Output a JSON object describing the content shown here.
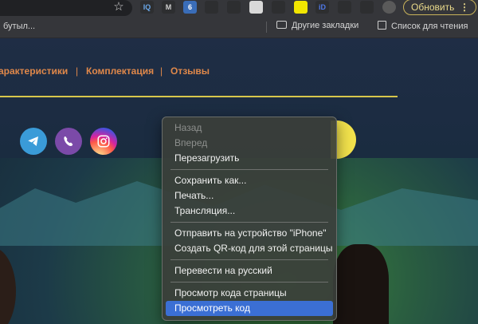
{
  "toolbar": {
    "update_label": "Обновить",
    "menu_glyph": "⋮",
    "extensions": [
      {
        "name": "iq-extension",
        "label": "IQ",
        "bg": "#2d2e30",
        "color": "#6aa7e8"
      },
      {
        "name": "m-extension",
        "label": "M",
        "bg": "#2d2e30",
        "color": "#cfcfcf"
      },
      {
        "name": "code-extension",
        "label": "6",
        "bg": "#3a6db8",
        "color": "#ffffff"
      },
      {
        "name": "feather-extension",
        "label": "",
        "bg": "#2d2e30",
        "color": "#5aa0e8"
      },
      {
        "name": "magnifier-extension",
        "label": "",
        "bg": "#2d2e30",
        "color": "#cfcfcf"
      },
      {
        "name": "note-extension",
        "label": "",
        "bg": "#d9d9d9",
        "color": "#333333"
      },
      {
        "name": "compass-extension",
        "label": "",
        "bg": "#2d2e30",
        "color": "#cfcfcf"
      },
      {
        "name": "yellow-extension",
        "label": "",
        "bg": "#f2e600",
        "color": "#000000"
      },
      {
        "name": "id-extension",
        "label": "iD",
        "bg": "#2d2e30",
        "color": "#4f78e8"
      },
      {
        "name": "puzzle-extension",
        "label": "",
        "bg": "#2d2e30",
        "color": "#cfcfcf"
      },
      {
        "name": "list-extension",
        "label": "",
        "bg": "#2d2e30",
        "color": "#cfcfcf"
      }
    ]
  },
  "bookmarks": {
    "cut_item": "бутыл...",
    "other_bookmarks": "Другие закладки",
    "reading_list": "Список для чтения"
  },
  "page": {
    "nav": [
      "арактеристики",
      "Комплектация",
      "Отзывы"
    ],
    "nav_separator": "|",
    "accent": "#e0884a"
  },
  "context_menu": {
    "groups": [
      [
        {
          "label": "Назад",
          "disabled": true
        },
        {
          "label": "Вперед",
          "disabled": true
        },
        {
          "label": "Перезагрузить",
          "disabled": false
        }
      ],
      [
        {
          "label": "Сохранить как...",
          "disabled": false
        },
        {
          "label": "Печать...",
          "disabled": false
        },
        {
          "label": "Трансляция...",
          "disabled": false
        }
      ],
      [
        {
          "label": "Отправить на устройство \"iPhone\"",
          "disabled": false
        },
        {
          "label": "Создать QR-код для этой страницы",
          "disabled": false
        }
      ],
      [
        {
          "label": "Перевести на русский",
          "disabled": false
        }
      ],
      [
        {
          "label": "Просмотр кода страницы",
          "disabled": false
        },
        {
          "label": "Просмотреть код",
          "disabled": false,
          "selected": true
        }
      ]
    ]
  }
}
